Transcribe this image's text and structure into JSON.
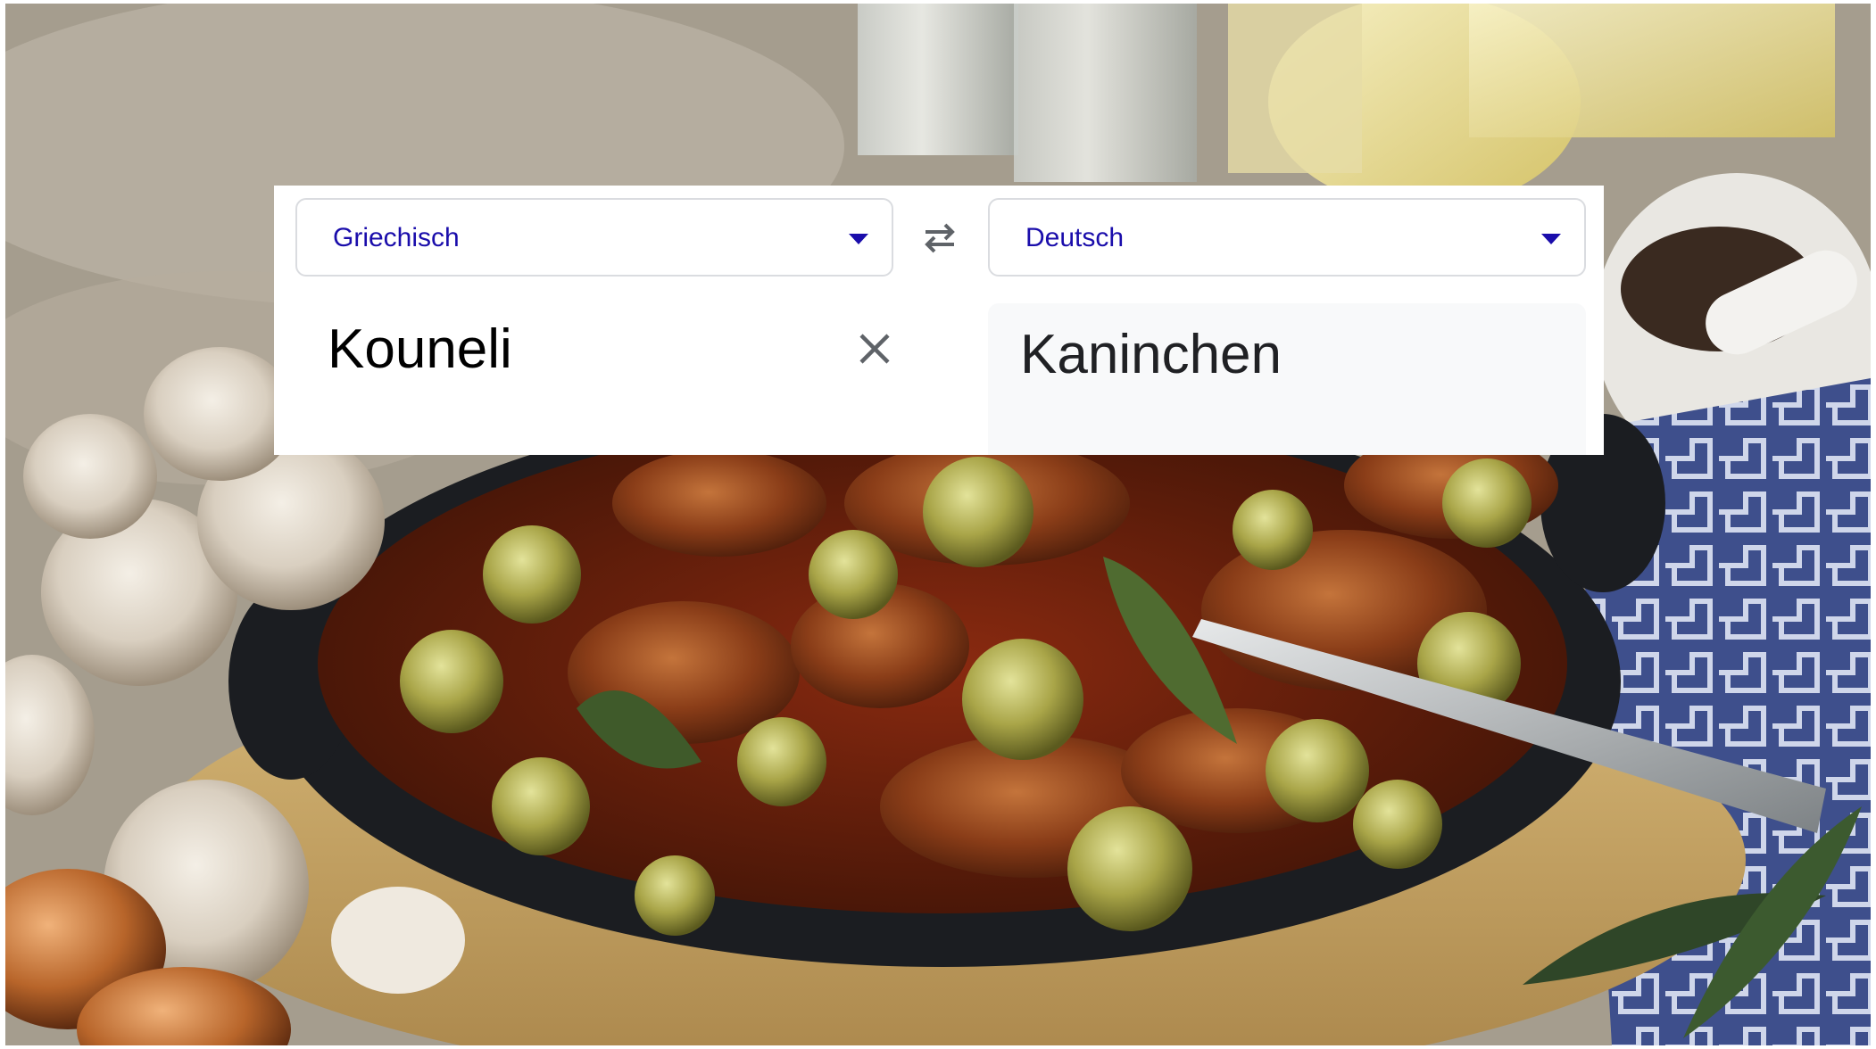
{
  "translator": {
    "source_language": "Griechisch",
    "target_language": "Deutsch",
    "source_text": "Kouneli",
    "translated_text": "Kaninchen",
    "icons": {
      "dropdown": "chevron-down-icon",
      "swap": "swap-languages-icon",
      "clear": "close-icon"
    },
    "colors": {
      "language_label": "#1a0dab",
      "border": "#dadce0",
      "target_background": "#f8f9fa",
      "icon_gray": "#5f6368"
    }
  }
}
